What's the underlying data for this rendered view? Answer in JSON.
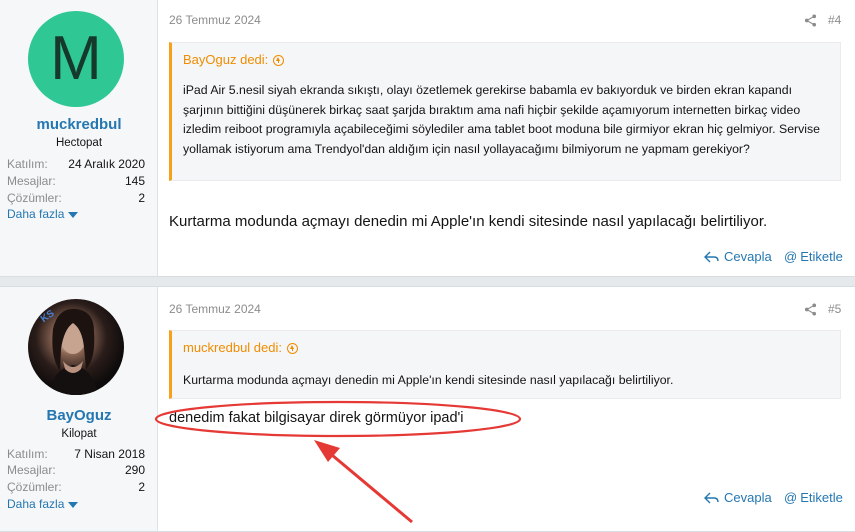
{
  "posts": [
    {
      "date": "26 Temmuz 2024",
      "number": "#4",
      "user": {
        "avatar_letter": "M",
        "name": "muckredbul",
        "title": "Hectopat",
        "stats": [
          {
            "label": "Katılım:",
            "value": "24 Aralık 2020"
          },
          {
            "label": "Mesajlar:",
            "value": "145"
          },
          {
            "label": "Çözümler:",
            "value": "2"
          }
        ],
        "more": "Daha fazla"
      },
      "quote": {
        "author": "BayOguz dedi:",
        "text": "iPad Air 5.nesil siyah ekranda sıkıştı, olayı özetlemek gerekirse babamla ev bakıyorduk ve birden ekran kapandı şarjının bittiğini düşünerek birkaç saat şarjda bıraktım ama nafi hiçbir şekilde açamıyorum internetten birkaç video izledim reiboot programıyla açabileceğimi söylediler ama tablet boot moduna bile girmiyor ekran hiç gelmiyor. Servise yollamak istiyorum ama Trendyol'dan aldığım için nasıl yollayacağımı bilmiyorum ne yapmam gerekiyor?"
      },
      "message": "Kurtarma modunda açmayı denedin mi Apple'ın kendi sitesinde nasıl yapılacağı belirtiliyor.",
      "reply": "Cevapla",
      "mention": "Etiketle"
    },
    {
      "date": "26 Temmuz 2024",
      "number": "#5",
      "user": {
        "badge": "KS",
        "name": "BayOguz",
        "title": "Kilopat",
        "stats": [
          {
            "label": "Katılım:",
            "value": "7 Nisan 2018"
          },
          {
            "label": "Mesajlar:",
            "value": "290"
          },
          {
            "label": "Çözümler:",
            "value": "2"
          }
        ],
        "more": "Daha fazla"
      },
      "quote": {
        "author": "muckredbul dedi:",
        "text": "Kurtarma modunda açmayı denedin mi Apple'ın kendi sitesinde nasıl yapılacağı belirtiliyor."
      },
      "message": "denedim fakat bilgisayar direk görmüyor ipad'i",
      "reply": "Cevapla",
      "mention": "Etiketle"
    }
  ],
  "colors": {
    "link": "#2577b1",
    "quote_accent": "#f7a01a",
    "annotation": "#e53935",
    "avatar_green": "#2fc894"
  }
}
